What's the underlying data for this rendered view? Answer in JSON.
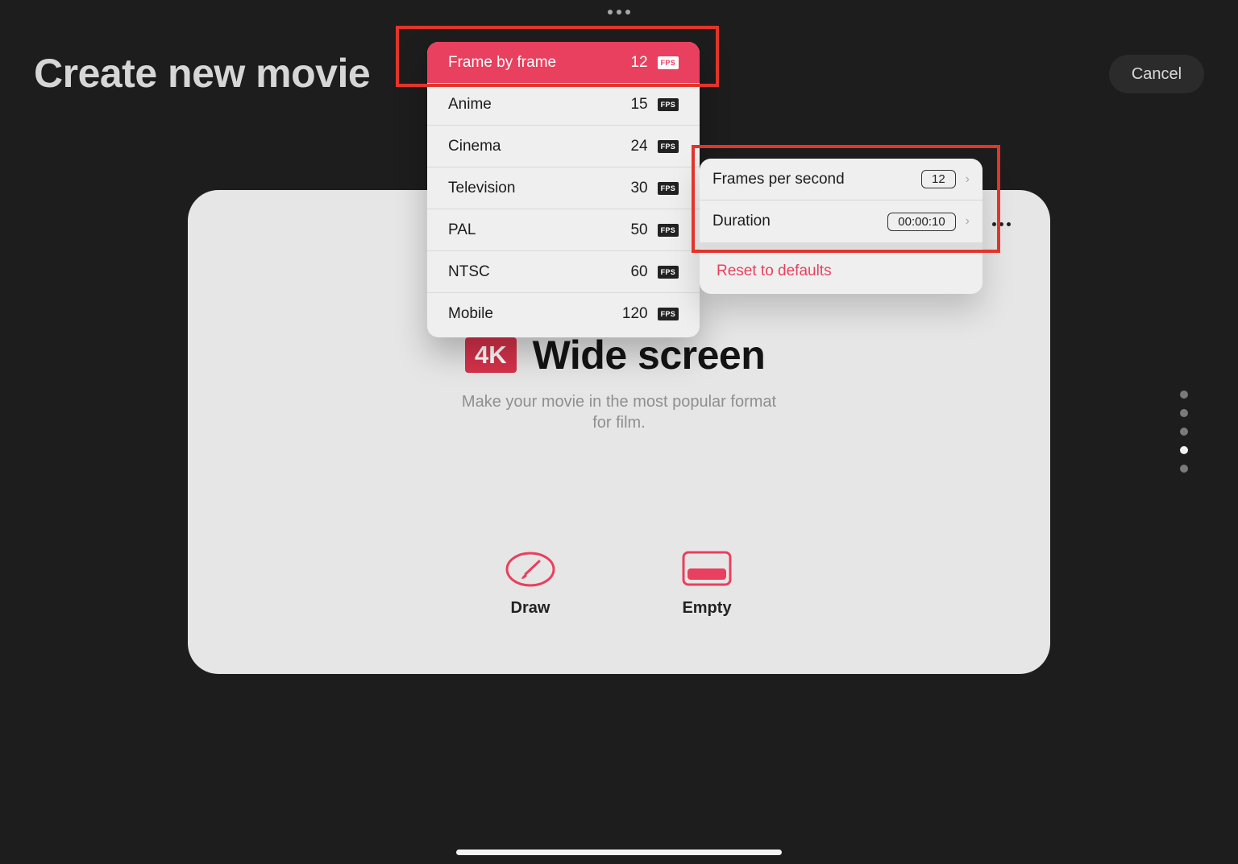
{
  "header": {
    "title": "Create new movie",
    "cancel_label": "Cancel"
  },
  "format": {
    "badge": "4K",
    "name": "Wide screen",
    "description": "Make your movie in the most popular format for film."
  },
  "options": [
    {
      "label": "Draw",
      "icon": "brush-icon"
    },
    {
      "label": "Empty",
      "icon": "empty-canvas-icon"
    }
  ],
  "page_indicator": {
    "count": 5,
    "active_index": 3
  },
  "fps_menu": {
    "items": [
      {
        "name": "Frame by frame",
        "value": "12",
        "unit": "FPS",
        "selected": true
      },
      {
        "name": "Anime",
        "value": "15",
        "unit": "FPS"
      },
      {
        "name": "Cinema",
        "value": "24",
        "unit": "FPS"
      },
      {
        "name": "Television",
        "value": "30",
        "unit": "FPS"
      },
      {
        "name": "PAL",
        "value": "50",
        "unit": "FPS"
      },
      {
        "name": "NTSC",
        "value": "60",
        "unit": "FPS"
      },
      {
        "name": "Mobile",
        "value": "120",
        "unit": "FPS"
      }
    ]
  },
  "settings": {
    "fps_label": "Frames per second",
    "fps_value": "12",
    "duration_label": "Duration",
    "duration_value": "00:00:10",
    "reset_label": "Reset to defaults"
  },
  "colors": {
    "accent": "#e8405e",
    "highlight": "#e3342a",
    "background": "#1d1d1d",
    "card": "#e6e6e6"
  }
}
